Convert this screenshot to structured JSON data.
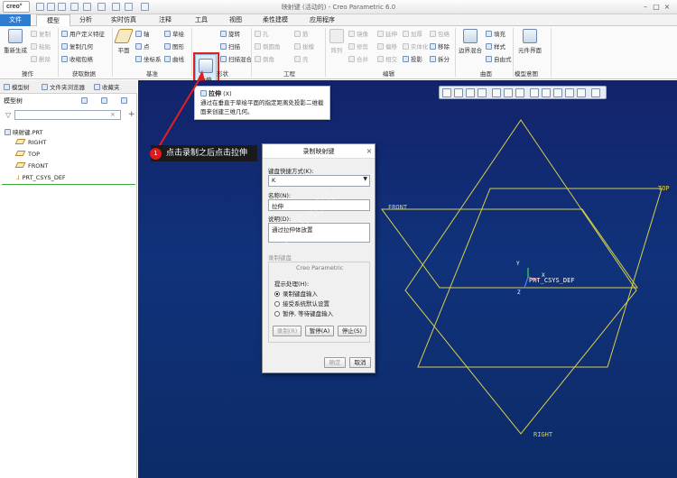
{
  "app": {
    "logo": "creo°",
    "window_title": "映射键 (活动的) - Creo Parametric 6.0"
  },
  "tabs": [
    "文件",
    "模型",
    "分析",
    "实时仿真",
    "注释",
    "工具",
    "视图",
    "柔性建模",
    "应用程序"
  ],
  "ribbon": {
    "operations": {
      "regen": "重新生成",
      "copy": "复制",
      "paste": "粘贴",
      "delete": "删除",
      "group_label": "操作"
    },
    "get_data": {
      "udf": "用户定义特征",
      "copy_geom": "复制几何",
      "shrinkwrap": "收缩包络",
      "group_label": "获取数据"
    },
    "datum": {
      "plane": "平面",
      "axis": "轴",
      "point": "点",
      "csys": "坐标系",
      "sketch": "草绘",
      "graph": "图形",
      "curve": "曲线",
      "group_label": "基准"
    },
    "shapes": {
      "extrude": "拉伸",
      "revolve": "旋转",
      "sweep": "扫描",
      "swept_blend": "扫描混合",
      "group_label": "形状"
    },
    "engineering": {
      "hole": "孔",
      "round": "倒圆角",
      "chamfer": "倒角",
      "rib": "筋",
      "draft": "拔模",
      "shell": "壳",
      "group_label": "工程"
    },
    "editing": {
      "pattern": "阵列",
      "mirror": "镜像",
      "trim": "修剪",
      "merge": "合并",
      "extend": "延伸",
      "offset": "偏移",
      "intersect": "相交",
      "thicken": "加厚",
      "solidify": "实体化",
      "project": "投影",
      "wrap": "包络",
      "remove": "移除",
      "split": "拆分",
      "group_label": "编辑"
    },
    "surfaces": {
      "boundary_blend": "边界混合",
      "fill": "填充",
      "style": "样式",
      "freestyle": "自由式",
      "group_label": "曲面"
    },
    "model_intent": {
      "component_interface": "元件界面",
      "group_label": "模型意图"
    }
  },
  "panel": {
    "tabs": [
      "模型树",
      "文件夹浏览器",
      "收藏夹"
    ],
    "tree_header": "模型树",
    "tree": [
      "映射键.PRT",
      "RIGHT",
      "TOP",
      "FRONT",
      "PRT_CSYS_DEF"
    ]
  },
  "tooltip": {
    "title": "拉伸",
    "shortcut": "(X)",
    "text": "通过在垂直于草绘平面的指定距离处投影二维截面来创建三维几何。"
  },
  "annotation": {
    "number": "1",
    "text": "点击录制之后点击拉伸"
  },
  "dialog": {
    "title": "录制映射键",
    "shortcut_label": "键盘快捷方式(K):",
    "shortcut_value": "K",
    "name_label": "名称(N):",
    "name_value": "拉伸",
    "desc_label": "说明(D):",
    "desc_value": "通过拉伸体放置",
    "record_tab": "录制键盘",
    "section_title": "Creo Parametric",
    "prompt_label": "提示处理(H):",
    "options": [
      "录制键盘输入",
      "接受系统默认设置",
      "暂停, 等待键盘输入"
    ],
    "selected_option": 0,
    "btn_record": "录制(R)",
    "btn_pause": "暂停(A)",
    "btn_stop": "停止(S)",
    "btn_ok": "确定",
    "btn_cancel": "取消"
  },
  "viewport": {
    "datum_labels": {
      "front": "FRONT",
      "top": "TOP",
      "right": "RIGHT",
      "csys": "PRT_CSYS_DEF",
      "x": "X",
      "y": "Y",
      "z": "Z"
    },
    "watermark": "92工业网"
  },
  "colors": {
    "accent": "#2f7dd1",
    "datum": "#d8d04a",
    "highlight": "#e02020",
    "background": "#10327a"
  }
}
